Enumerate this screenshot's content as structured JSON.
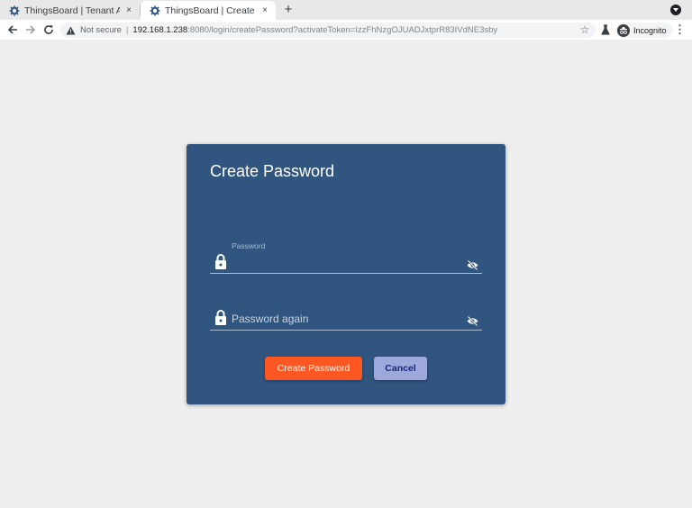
{
  "browser": {
    "tabs": [
      {
        "title": "ThingsBoard | Tenant Ad",
        "active": false,
        "close": "×"
      },
      {
        "title": "ThingsBoard | Create Pa",
        "active": true,
        "close": "×"
      }
    ],
    "new_tab": "+",
    "address_bar": {
      "security_text": "Not secure",
      "separator": "|",
      "host": "192.168.1.238",
      "path": ":8080/login/createPassword?activateToken=IzzFhNzgOJUADJxtprR83IVdNE3sby"
    },
    "incognito_label": "Incognito",
    "icons": {
      "back": "arrow-left-icon",
      "forward": "arrow-right-icon",
      "reload": "reload-icon",
      "warning": "warning-triangle-icon",
      "bookmark": "star-icon",
      "extension": "flask-icon",
      "menu": "kebab-menu-icon"
    }
  },
  "form": {
    "title": "Create Password",
    "password_label": "Password",
    "password_again_placeholder": "Password again",
    "create_button": "Create Password",
    "cancel_button": "Cancel"
  },
  "colors": {
    "card_bg": "#305680",
    "primary_button": "#ff5722",
    "cancel_button": "#9fa8da",
    "page_bg": "#eeeeee"
  }
}
